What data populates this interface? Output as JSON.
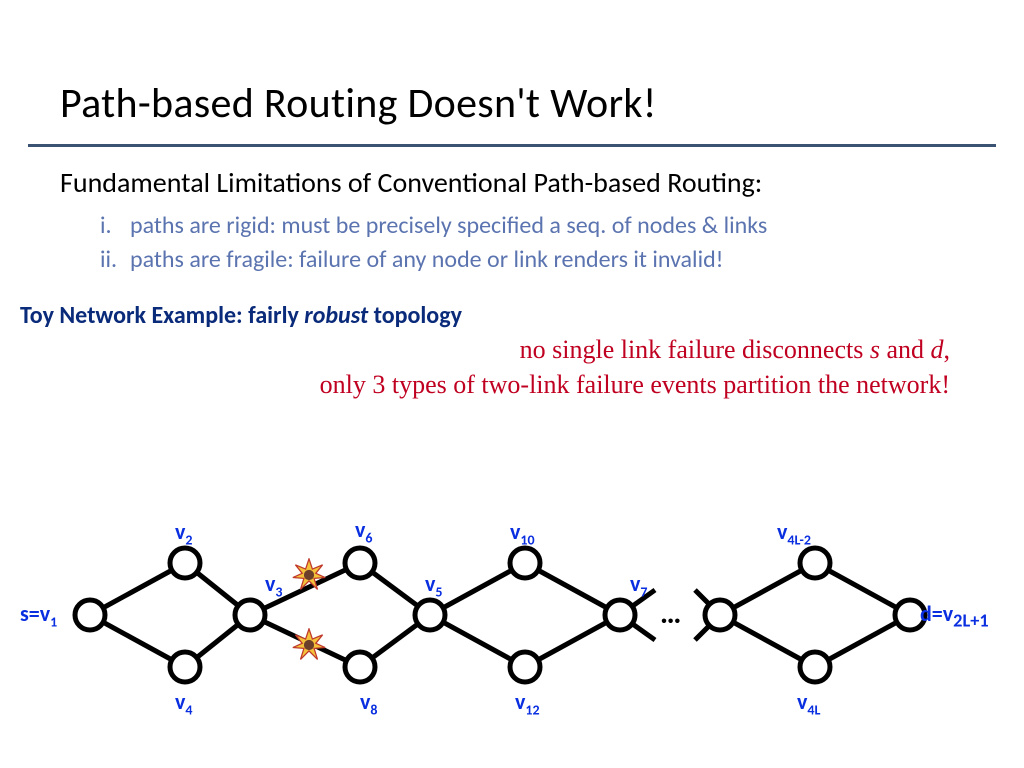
{
  "title": "Path-based Routing Doesn't Work!",
  "subhead": "Fundamental Limitations of Conventional Path-based Routing:",
  "list": {
    "i": "i.",
    "i_text": "paths are rigid: must be precisely specified a seq. of nodes & links",
    "ii": "ii.",
    "ii_text": "paths are fragile: failure of any node or link renders it invalid!"
  },
  "toy_prefix": "Toy Network Example: fairly ",
  "toy_ital": "robust",
  "toy_suffix": " topology",
  "red1_a": "no single link failure disconnects ",
  "red1_s": "s",
  "red1_b": " and ",
  "red1_d": "d",
  "red1_c": ",",
  "red2": "only 3 types of two-link failure events partition the network!",
  "labels": {
    "s": "s=v",
    "s_sub": "1",
    "v2": "v",
    "v2_sub": "2",
    "v3": "v",
    "v3_sub": "3",
    "v4": "v",
    "v4_sub": "4",
    "v5": "v",
    "v5_sub": "5",
    "v6": "v",
    "v6_sub": "6",
    "v7": "v",
    "v7_sub": "7",
    "v8": "v",
    "v8_sub": "8",
    "v10": "v",
    "v10_sub": "10",
    "v12": "v",
    "v12_sub": "12",
    "v4l2": "v",
    "v4l2_sub": "4L-2",
    "v4l": "v",
    "v4l_sub": "4L",
    "d": "d=v",
    "d_sub": "2L+1"
  },
  "dots": "…"
}
